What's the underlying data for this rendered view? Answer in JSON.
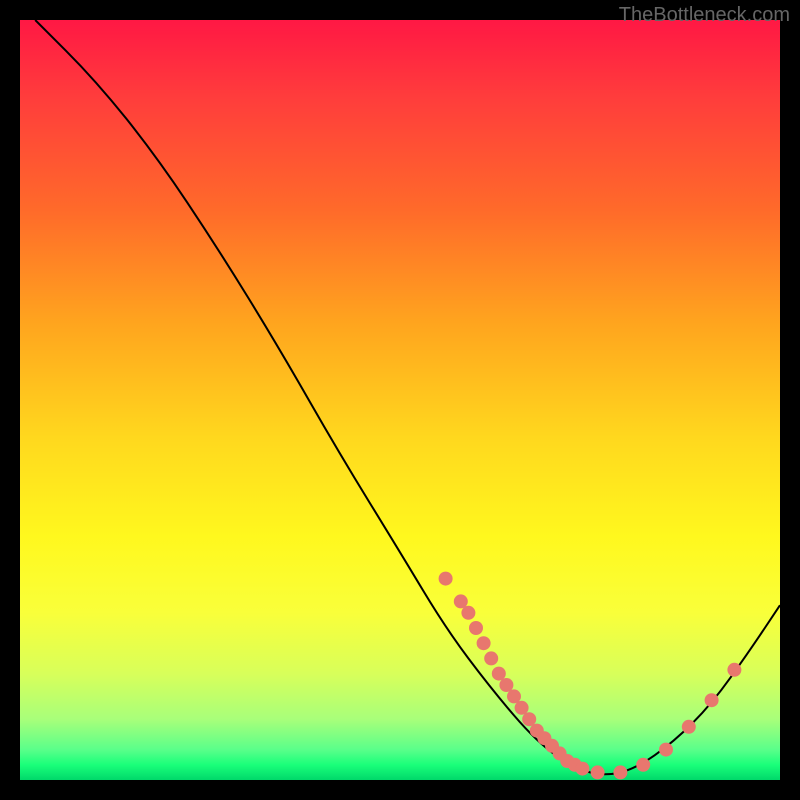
{
  "watermark": "TheBottleneck.com",
  "chart_data": {
    "type": "line",
    "title": "",
    "xlabel": "",
    "ylabel": "",
    "xlim": [
      0,
      100
    ],
    "ylim": [
      0,
      100
    ],
    "curve": [
      {
        "x": 2,
        "y": 100
      },
      {
        "x": 10,
        "y": 92
      },
      {
        "x": 18,
        "y": 82
      },
      {
        "x": 26,
        "y": 70
      },
      {
        "x": 34,
        "y": 57
      },
      {
        "x": 42,
        "y": 43
      },
      {
        "x": 50,
        "y": 30
      },
      {
        "x": 56,
        "y": 20
      },
      {
        "x": 62,
        "y": 12
      },
      {
        "x": 68,
        "y": 5
      },
      {
        "x": 73,
        "y": 1.5
      },
      {
        "x": 77,
        "y": 0.5
      },
      {
        "x": 81,
        "y": 1.5
      },
      {
        "x": 86,
        "y": 5
      },
      {
        "x": 91,
        "y": 10
      },
      {
        "x": 96,
        "y": 17
      },
      {
        "x": 100,
        "y": 23
      }
    ],
    "markers": [
      {
        "x": 56,
        "y": 26.5
      },
      {
        "x": 58,
        "y": 23.5
      },
      {
        "x": 59,
        "y": 22
      },
      {
        "x": 60,
        "y": 20
      },
      {
        "x": 61,
        "y": 18
      },
      {
        "x": 62,
        "y": 16
      },
      {
        "x": 63,
        "y": 14
      },
      {
        "x": 64,
        "y": 12.5
      },
      {
        "x": 65,
        "y": 11
      },
      {
        "x": 66,
        "y": 9.5
      },
      {
        "x": 67,
        "y": 8
      },
      {
        "x": 68,
        "y": 6.5
      },
      {
        "x": 69,
        "y": 5.5
      },
      {
        "x": 70,
        "y": 4.5
      },
      {
        "x": 71,
        "y": 3.5
      },
      {
        "x": 72,
        "y": 2.5
      },
      {
        "x": 73,
        "y": 2
      },
      {
        "x": 74,
        "y": 1.5
      },
      {
        "x": 76,
        "y": 1
      },
      {
        "x": 79,
        "y": 1
      },
      {
        "x": 82,
        "y": 2
      },
      {
        "x": 85,
        "y": 4
      },
      {
        "x": 88,
        "y": 7
      },
      {
        "x": 91,
        "y": 10.5
      },
      {
        "x": 94,
        "y": 14.5
      }
    ],
    "gradient_colors": {
      "top": "#ff1844",
      "upper_mid": "#ffa51e",
      "mid": "#fff81e",
      "lower_mid": "#a8ff7a",
      "bottom": "#00d86a"
    },
    "marker_color": "#e8776e",
    "curve_color": "#000000"
  }
}
